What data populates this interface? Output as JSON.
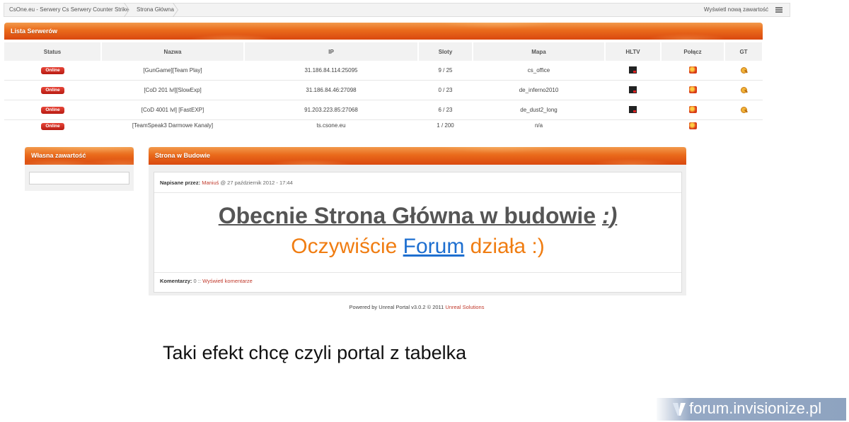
{
  "breadcrumb": [
    "CsOne.eu - Serwery Cs Serwery Counter Strike",
    "Strona Główna"
  ],
  "header_right": {
    "new_content": "Wyświetl nową zawartość",
    "icon": "list-icon"
  },
  "servers_panel": {
    "title": "Lista Serwerów",
    "columns": [
      "Status",
      "Nazwa",
      "IP",
      "Sloty",
      "Mapa",
      "HLTV",
      "Połącz",
      "GT"
    ],
    "rows": [
      {
        "status": "Online",
        "name": "[GunGame][Team Play]",
        "ip": "31.186.84.114:25095",
        "slots": "9 / 25",
        "map": "cs_office",
        "hltv": true,
        "connect": true,
        "gt": true
      },
      {
        "status": "Online",
        "name": "[CoD 201 lvl][SlowExp]",
        "ip": "31.186.84.46:27098",
        "slots": "0 / 23",
        "map": "de_inferno2010",
        "hltv": true,
        "connect": true,
        "gt": true
      },
      {
        "status": "Online",
        "name": "[CoD 4001 lvl] [FastEXP]",
        "ip": "91.203.223.85:27068",
        "slots": "6 / 23",
        "map": "de_dust2_long",
        "hltv": true,
        "connect": true,
        "gt": true
      },
      {
        "status": "Online",
        "name": "[TeamSpeak3 Darmowe Kanaly]",
        "ip": "ts.csone.eu",
        "slots": "1 / 200",
        "map": "n/a",
        "hltv": false,
        "connect": true,
        "gt": false
      }
    ]
  },
  "sidebar": {
    "title": "Własna zawartość",
    "input_value": ""
  },
  "post": {
    "title": "Strona w Budowie",
    "posted_by_label": "Napisane przez:",
    "author": "Maniuś",
    "date": "@ 27 październik 2012 - 17:44",
    "headline": "Obecnie Strona Główna w budowie",
    "headline_smiley": ":)",
    "sub_before": "Oczywiście",
    "sub_link": "Forum",
    "sub_after": "działa :)",
    "comments_label": "Komentarzy:",
    "comments_count": "0",
    "comments_sep": "::",
    "view_comments": "Wyświetl komentarze"
  },
  "footer": {
    "powered": "Powered by Unreal Portal v3.0.2 © 2011",
    "powered_link": "Unreal Solutions"
  },
  "caption": "Taki efekt chcę czyli portal z tabelka",
  "watermark": "forum.invisionize.pl",
  "colors": {
    "accent_orange": "#ea6a1b",
    "online_red": "#c8241a",
    "link_red": "#c0392b",
    "sub_orange": "#f07d12",
    "link_blue": "#1e6fd0"
  }
}
